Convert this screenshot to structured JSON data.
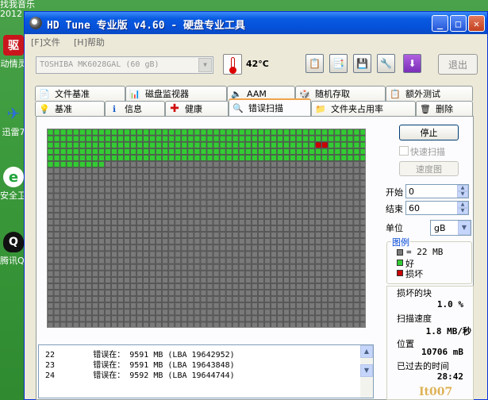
{
  "desktop": {
    "top_text_1": "找我音乐",
    "top_text_2": "2012",
    "icons": [
      {
        "label": "动情灵",
        "glyph": "驱",
        "color": "#c9161d"
      },
      {
        "label": "迅雷7",
        "glyph": "✈",
        "color": "#2a6dd8"
      },
      {
        "label": "安全卫士",
        "glyph": "e",
        "color": "#1fa33a"
      },
      {
        "label": "腾讯QQ",
        "glyph": "Q",
        "color": "#111111"
      }
    ]
  },
  "window": {
    "title": "HD Tune 专业版 v4.60 - 硬盘专业工具",
    "buttons": {
      "minimize": "_",
      "maximize": "□",
      "close": "✕"
    }
  },
  "menu": {
    "file": "[F]文件",
    "help": "[H]帮助"
  },
  "toolbar": {
    "drive": "TOSHIBA MK6028GAL (60 gB)",
    "temperature": "42°C",
    "exit_label": "退出"
  },
  "tabs_row1": [
    {
      "label": "文件基准",
      "icon": "document-icon"
    },
    {
      "label": "磁盘监视器",
      "icon": "chart-icon"
    },
    {
      "label": "AAM",
      "icon": "speaker-icon"
    },
    {
      "label": "随机存取",
      "icon": "dice-icon"
    },
    {
      "label": "额外测试",
      "icon": "clipboard-icon"
    }
  ],
  "tabs_row2": [
    {
      "label": "基准",
      "icon": "lightbulb-icon"
    },
    {
      "label": "信息",
      "icon": "info-icon"
    },
    {
      "label": "健康",
      "icon": "health-cross-icon"
    },
    {
      "label": "错误扫描",
      "icon": "magnifier-icon",
      "active": true
    },
    {
      "label": "文件夹占用率",
      "icon": "folder-icon"
    },
    {
      "label": "删除",
      "icon": "trash-icon"
    }
  ],
  "scan": {
    "stop_label": "停止",
    "quick_scan_label": "快速扫描",
    "speed_map_label": "速度图",
    "start_label": "开始",
    "start_value": "0",
    "end_label": "结束",
    "end_value": "60",
    "unit_label": "单位",
    "unit_value": "gB",
    "grid": {
      "scanned_fraction": 0.167,
      "damaged_fraction": 0.001,
      "colors": {
        "good": "#33cc33",
        "unscanned": "#7a7a7a",
        "damaged": "#cc0000"
      }
    }
  },
  "legend": {
    "title": "图例",
    "block_size": "= 22 MB",
    "good": "好",
    "damaged": "损坏"
  },
  "stats": {
    "damaged_blocks_label": "损坏的块",
    "damaged_blocks_value": "1.0 %",
    "scan_speed_label": "扫描速度",
    "scan_speed_value": "1.8 MB/秒",
    "position_label": "位置",
    "position_value": "10706 mB",
    "elapsed_label": "已过去的时间",
    "elapsed_value": "28:42"
  },
  "log": [
    {
      "num": "22",
      "text": "错误在： 9591 MB (LBA 19642952)"
    },
    {
      "num": "23",
      "text": "错误在： 9591 MB (LBA 19643848)"
    },
    {
      "num": "24",
      "text": "错误在： 9592 MB (LBA 19644744)"
    }
  ],
  "watermark": "It007"
}
